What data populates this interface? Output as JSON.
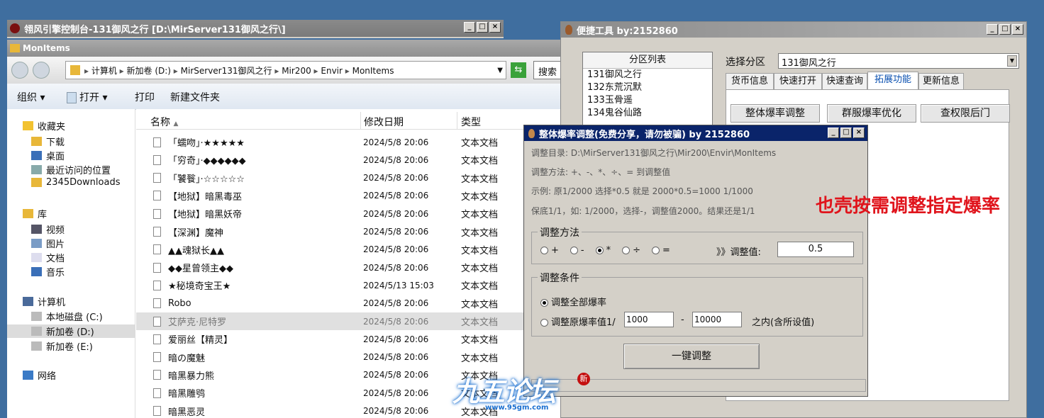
{
  "console": {
    "title": "翎风引擎控制台-131御风之行 [D:\\MirServer131御风之行\\]",
    "buttons": {
      "min": "_",
      "max": "□",
      "close": "×"
    }
  },
  "explorer": {
    "title": "MonItems",
    "breadcrumb": [
      "计算机",
      "新加卷 (D:)",
      "MirServer131御风之行",
      "Mir200",
      "Envir",
      "MonItems"
    ],
    "search_placeholder": "搜索",
    "toolbar": {
      "organize": "组织",
      "open": "打开",
      "print": "打印",
      "new_folder": "新建文件夹"
    },
    "nav": {
      "favorites": "收藏夹",
      "fav_items": [
        "下载",
        "桌面",
        "最近访问的位置",
        "2345Downloads"
      ],
      "libraries": "库",
      "lib_items": [
        "视频",
        "图片",
        "文档",
        "音乐"
      ],
      "computer": "计算机",
      "drives": [
        "本地磁盘 (C:)",
        "新加卷 (D:)",
        "新加卷 (E:)"
      ],
      "network": "网络"
    },
    "columns": {
      "name": "名称",
      "date": "修改日期",
      "type": "类型"
    },
    "files": [
      {
        "name": "「蠕吻」·★★★★★",
        "date": "2024/5/8 20:06",
        "type": "文本文档"
      },
      {
        "name": "「穷奇」·◆◆◆◆◆◆",
        "date": "2024/5/8 20:06",
        "type": "文本文档"
      },
      {
        "name": "「饕餮」·☆☆☆☆☆",
        "date": "2024/5/8 20:06",
        "type": "文本文档"
      },
      {
        "name": "【地狱】暗黑毒巫",
        "date": "2024/5/8 20:06",
        "type": "文本文档"
      },
      {
        "name": "【地狱】暗黑妖帝",
        "date": "2024/5/8 20:06",
        "type": "文本文档"
      },
      {
        "name": "【深渊】魔神",
        "date": "2024/5/8 20:06",
        "type": "文本文档"
      },
      {
        "name": "▲▲魂狱长▲▲",
        "date": "2024/5/8 20:06",
        "type": "文本文档"
      },
      {
        "name": "◆◆星曾领主◆◆",
        "date": "2024/5/8 20:06",
        "type": "文本文档"
      },
      {
        "name": "★秘境奇宝王★",
        "date": "2024/5/13 15:03",
        "type": "文本文档"
      },
      {
        "name": "Robo",
        "date": "2024/5/8 20:06",
        "type": "文本文档"
      },
      {
        "name": "艾萨克·尼特罗",
        "date": "2024/5/8 20:06",
        "type": "文本文档"
      },
      {
        "name": "爱丽丝【精灵】",
        "date": "2024/5/8 20:06",
        "type": "文本文档"
      },
      {
        "name": "暗の魔魅",
        "date": "2024/5/8 20:06",
        "type": "文本文档"
      },
      {
        "name": "暗黑暴力熊",
        "date": "2024/5/8 20:06",
        "type": "文本文档"
      },
      {
        "name": "暗黑雕鸮",
        "date": "2024/5/8 20:06",
        "type": "文本文档"
      },
      {
        "name": "暗黑恶灵",
        "date": "2024/5/8 20:06",
        "type": "文本文档"
      }
    ]
  },
  "tool": {
    "title": "便捷工具  by:2152860",
    "partition_header": "分区列表",
    "partitions": [
      "131御风之行",
      "132东荒沉默",
      "133玉骨遥",
      "134鬼谷仙路"
    ],
    "select_label": "选择分区",
    "select_value": "131御风之行",
    "tabs": [
      "货币信息",
      "快速打开",
      "快速查询",
      "拓展功能",
      "更新信息"
    ],
    "buttons": [
      "整体爆率调整",
      "群服爆率优化",
      "查权限后门"
    ]
  },
  "dialog": {
    "title": "整体爆率调整(免费分享，请勿被骗)  by 2152860",
    "dir_label": "调整目录: D:\\MirServer131御风之行\\Mir200\\Envir\\MonItems",
    "method_text": "调整方法: +、-、*、÷、=  到调整值",
    "example_text": "示例: 原1/2000 选择*0.5 就是 2000*0.5=1000  1/1000",
    "floor_text": "保底1/1，如: 1/2000，选择-，调整值2000。结果还是1/1",
    "method_group": "调整方法",
    "ops": [
      "+",
      "-",
      "*",
      "÷",
      "="
    ],
    "selected_op": "*",
    "value_label": "》》调整值:",
    "value": "0.5",
    "cond_group": "调整条件",
    "cond_all": "调整全部爆率",
    "cond_range": "调整原爆率值1/",
    "range_from": "1000",
    "range_dash": "-",
    "range_to": "10000",
    "range_suffix": "之内(含所设值)",
    "apply_button": "一键调整"
  },
  "annotation": "也壳按需调整指定爆率",
  "watermark": {
    "logo": "九五论坛",
    "url": "www.95gm.com"
  },
  "colors": {
    "titlebar_blue": "#0a246a",
    "titlebar_gray": "#808080",
    "annotation_red": "#e0141c",
    "selected_row": "#e0e0e0",
    "desktop": "#3f6e9f"
  }
}
